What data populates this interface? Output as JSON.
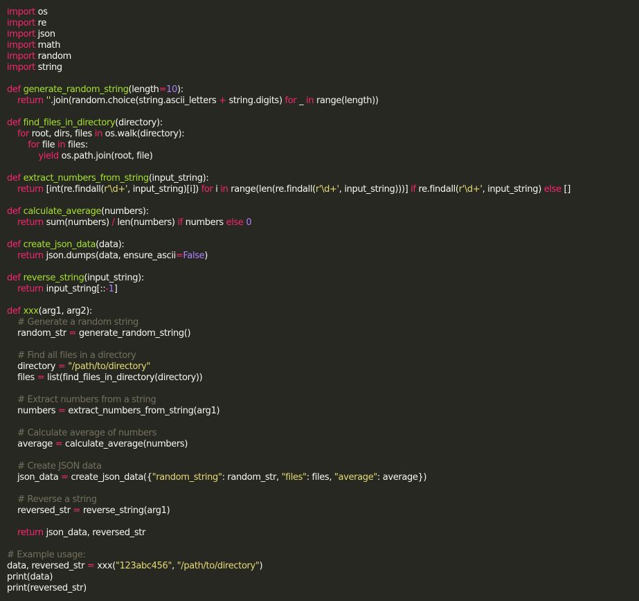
{
  "editor": {
    "theme": {
      "background": "#272822",
      "foreground": "#f8f8f2",
      "keyword": "#f92672",
      "function": "#a6e22e",
      "string": "#e6db74",
      "number": "#ae81ff",
      "comment": "#75715e"
    },
    "lines": [
      [
        {
          "t": "kw",
          "v": "import"
        },
        {
          "t": "txt",
          "v": " os"
        }
      ],
      [
        {
          "t": "kw",
          "v": "import"
        },
        {
          "t": "txt",
          "v": " re"
        }
      ],
      [
        {
          "t": "kw",
          "v": "import"
        },
        {
          "t": "txt",
          "v": " json"
        }
      ],
      [
        {
          "t": "kw",
          "v": "import"
        },
        {
          "t": "txt",
          "v": " math"
        }
      ],
      [
        {
          "t": "kw",
          "v": "import"
        },
        {
          "t": "txt",
          "v": " random"
        }
      ],
      [
        {
          "t": "kw",
          "v": "import"
        },
        {
          "t": "txt",
          "v": " string"
        }
      ],
      [],
      [
        {
          "t": "kw",
          "v": "def"
        },
        {
          "t": "txt",
          "v": " "
        },
        {
          "t": "fn",
          "v": "generate_random_string"
        },
        {
          "t": "txt",
          "v": "(length"
        },
        {
          "t": "op",
          "v": "="
        },
        {
          "t": "num",
          "v": "10"
        },
        {
          "t": "txt",
          "v": "):"
        }
      ],
      [
        {
          "t": "txt",
          "v": "    "
        },
        {
          "t": "kw",
          "v": "return"
        },
        {
          "t": "txt",
          "v": " "
        },
        {
          "t": "str",
          "v": "''"
        },
        {
          "t": "txt",
          "v": ".join(random.choice(string.ascii_letters "
        },
        {
          "t": "op",
          "v": "+"
        },
        {
          "t": "txt",
          "v": " string.digits) "
        },
        {
          "t": "kw",
          "v": "for"
        },
        {
          "t": "txt",
          "v": " _ "
        },
        {
          "t": "kw",
          "v": "in"
        },
        {
          "t": "txt",
          "v": " range(length))"
        }
      ],
      [],
      [
        {
          "t": "kw",
          "v": "def"
        },
        {
          "t": "txt",
          "v": " "
        },
        {
          "t": "fn",
          "v": "find_files_in_directory"
        },
        {
          "t": "txt",
          "v": "(directory):"
        }
      ],
      [
        {
          "t": "txt",
          "v": "    "
        },
        {
          "t": "kw",
          "v": "for"
        },
        {
          "t": "txt",
          "v": " root, dirs, files "
        },
        {
          "t": "kw",
          "v": "in"
        },
        {
          "t": "txt",
          "v": " os.walk(directory):"
        }
      ],
      [
        {
          "t": "txt",
          "v": "        "
        },
        {
          "t": "kw",
          "v": "for"
        },
        {
          "t": "txt",
          "v": " file "
        },
        {
          "t": "kw",
          "v": "in"
        },
        {
          "t": "txt",
          "v": " files:"
        }
      ],
      [
        {
          "t": "txt",
          "v": "            "
        },
        {
          "t": "kw",
          "v": "yield"
        },
        {
          "t": "txt",
          "v": " os.path.join(root, file)"
        }
      ],
      [],
      [
        {
          "t": "kw",
          "v": "def"
        },
        {
          "t": "txt",
          "v": " "
        },
        {
          "t": "fn",
          "v": "extract_numbers_from_string"
        },
        {
          "t": "txt",
          "v": "(input_string):"
        }
      ],
      [
        {
          "t": "txt",
          "v": "    "
        },
        {
          "t": "kw",
          "v": "return"
        },
        {
          "t": "txt",
          "v": " [int(re.findall("
        },
        {
          "t": "str",
          "v": "r'\\d+'"
        },
        {
          "t": "txt",
          "v": ", input_string)[i]) "
        },
        {
          "t": "kw",
          "v": "for"
        },
        {
          "t": "txt",
          "v": " i "
        },
        {
          "t": "kw",
          "v": "in"
        },
        {
          "t": "txt",
          "v": " range(len(re.findall("
        },
        {
          "t": "str",
          "v": "r'\\d+'"
        },
        {
          "t": "txt",
          "v": ", input_string)))] "
        },
        {
          "t": "kw",
          "v": "if"
        },
        {
          "t": "txt",
          "v": " re.findall("
        },
        {
          "t": "str",
          "v": "r'\\d+'"
        },
        {
          "t": "txt",
          "v": ", input_string) "
        },
        {
          "t": "kw",
          "v": "else"
        },
        {
          "t": "txt",
          "v": " []"
        }
      ],
      [],
      [
        {
          "t": "kw",
          "v": "def"
        },
        {
          "t": "txt",
          "v": " "
        },
        {
          "t": "fn",
          "v": "calculate_average"
        },
        {
          "t": "txt",
          "v": "(numbers):"
        }
      ],
      [
        {
          "t": "txt",
          "v": "    "
        },
        {
          "t": "kw",
          "v": "return"
        },
        {
          "t": "txt",
          "v": " sum(numbers) "
        },
        {
          "t": "op",
          "v": "/"
        },
        {
          "t": "txt",
          "v": " len(numbers) "
        },
        {
          "t": "kw",
          "v": "if"
        },
        {
          "t": "txt",
          "v": " numbers "
        },
        {
          "t": "kw",
          "v": "else"
        },
        {
          "t": "txt",
          "v": " "
        },
        {
          "t": "num",
          "v": "0"
        }
      ],
      [],
      [
        {
          "t": "kw",
          "v": "def"
        },
        {
          "t": "txt",
          "v": " "
        },
        {
          "t": "fn",
          "v": "create_json_data"
        },
        {
          "t": "txt",
          "v": "(data):"
        }
      ],
      [
        {
          "t": "txt",
          "v": "    "
        },
        {
          "t": "kw",
          "v": "return"
        },
        {
          "t": "txt",
          "v": " json.dumps(data, ensure_ascii"
        },
        {
          "t": "op",
          "v": "="
        },
        {
          "t": "num",
          "v": "False"
        },
        {
          "t": "txt",
          "v": ")"
        }
      ],
      [],
      [
        {
          "t": "kw",
          "v": "def"
        },
        {
          "t": "txt",
          "v": " "
        },
        {
          "t": "fn",
          "v": "reverse_string"
        },
        {
          "t": "txt",
          "v": "(input_string):"
        }
      ],
      [
        {
          "t": "txt",
          "v": "    "
        },
        {
          "t": "kw",
          "v": "return"
        },
        {
          "t": "txt",
          "v": " input_string[::"
        },
        {
          "t": "op",
          "v": "-"
        },
        {
          "t": "num",
          "v": "1"
        },
        {
          "t": "txt",
          "v": "]"
        }
      ],
      [],
      [
        {
          "t": "kw",
          "v": "def"
        },
        {
          "t": "txt",
          "v": " "
        },
        {
          "t": "fn",
          "v": "xxx"
        },
        {
          "t": "txt",
          "v": "(arg1, arg2):"
        }
      ],
      [
        {
          "t": "txt",
          "v": "    "
        },
        {
          "t": "cm",
          "v": "# Generate a random string"
        }
      ],
      [
        {
          "t": "txt",
          "v": "    random_str "
        },
        {
          "t": "op",
          "v": "="
        },
        {
          "t": "txt",
          "v": " generate_random_string()"
        }
      ],
      [],
      [
        {
          "t": "txt",
          "v": "    "
        },
        {
          "t": "cm",
          "v": "# Find all files in a directory"
        }
      ],
      [
        {
          "t": "txt",
          "v": "    directory "
        },
        {
          "t": "op",
          "v": "="
        },
        {
          "t": "txt",
          "v": " "
        },
        {
          "t": "str",
          "v": "\"/path/to/directory\""
        }
      ],
      [
        {
          "t": "txt",
          "v": "    files "
        },
        {
          "t": "op",
          "v": "="
        },
        {
          "t": "txt",
          "v": " list(find_files_in_directory(directory))"
        }
      ],
      [],
      [
        {
          "t": "txt",
          "v": "    "
        },
        {
          "t": "cm",
          "v": "# Extract numbers from a string"
        }
      ],
      [
        {
          "t": "txt",
          "v": "    numbers "
        },
        {
          "t": "op",
          "v": "="
        },
        {
          "t": "txt",
          "v": " extract_numbers_from_string(arg1)"
        }
      ],
      [],
      [
        {
          "t": "txt",
          "v": "    "
        },
        {
          "t": "cm",
          "v": "# Calculate average of numbers"
        }
      ],
      [
        {
          "t": "txt",
          "v": "    average "
        },
        {
          "t": "op",
          "v": "="
        },
        {
          "t": "txt",
          "v": " calculate_average(numbers)"
        }
      ],
      [],
      [
        {
          "t": "txt",
          "v": "    "
        },
        {
          "t": "cm",
          "v": "# Create JSON data"
        }
      ],
      [
        {
          "t": "txt",
          "v": "    json_data "
        },
        {
          "t": "op",
          "v": "="
        },
        {
          "t": "txt",
          "v": " create_json_data({"
        },
        {
          "t": "str",
          "v": "\"random_string\""
        },
        {
          "t": "txt",
          "v": ": random_str, "
        },
        {
          "t": "str",
          "v": "\"files\""
        },
        {
          "t": "txt",
          "v": ": files, "
        },
        {
          "t": "str",
          "v": "\"average\""
        },
        {
          "t": "txt",
          "v": ": average})"
        }
      ],
      [],
      [
        {
          "t": "txt",
          "v": "    "
        },
        {
          "t": "cm",
          "v": "# Reverse a string"
        }
      ],
      [
        {
          "t": "txt",
          "v": "    reversed_str "
        },
        {
          "t": "op",
          "v": "="
        },
        {
          "t": "txt",
          "v": " reverse_string(arg1)"
        }
      ],
      [],
      [
        {
          "t": "txt",
          "v": "    "
        },
        {
          "t": "kw",
          "v": "return"
        },
        {
          "t": "txt",
          "v": " json_data, reversed_str"
        }
      ],
      [],
      [
        {
          "t": "cm",
          "v": "# Example usage:"
        }
      ],
      [
        {
          "t": "txt",
          "v": "data, reversed_str "
        },
        {
          "t": "op",
          "v": "="
        },
        {
          "t": "txt",
          "v": " xxx("
        },
        {
          "t": "str",
          "v": "\"123abc456\""
        },
        {
          "t": "txt",
          "v": ", "
        },
        {
          "t": "str",
          "v": "\"/path/to/directory\""
        },
        {
          "t": "txt",
          "v": ")"
        }
      ],
      [
        {
          "t": "txt",
          "v": "print(data)"
        }
      ],
      [
        {
          "t": "txt",
          "v": "print(reversed_str)"
        }
      ]
    ]
  }
}
